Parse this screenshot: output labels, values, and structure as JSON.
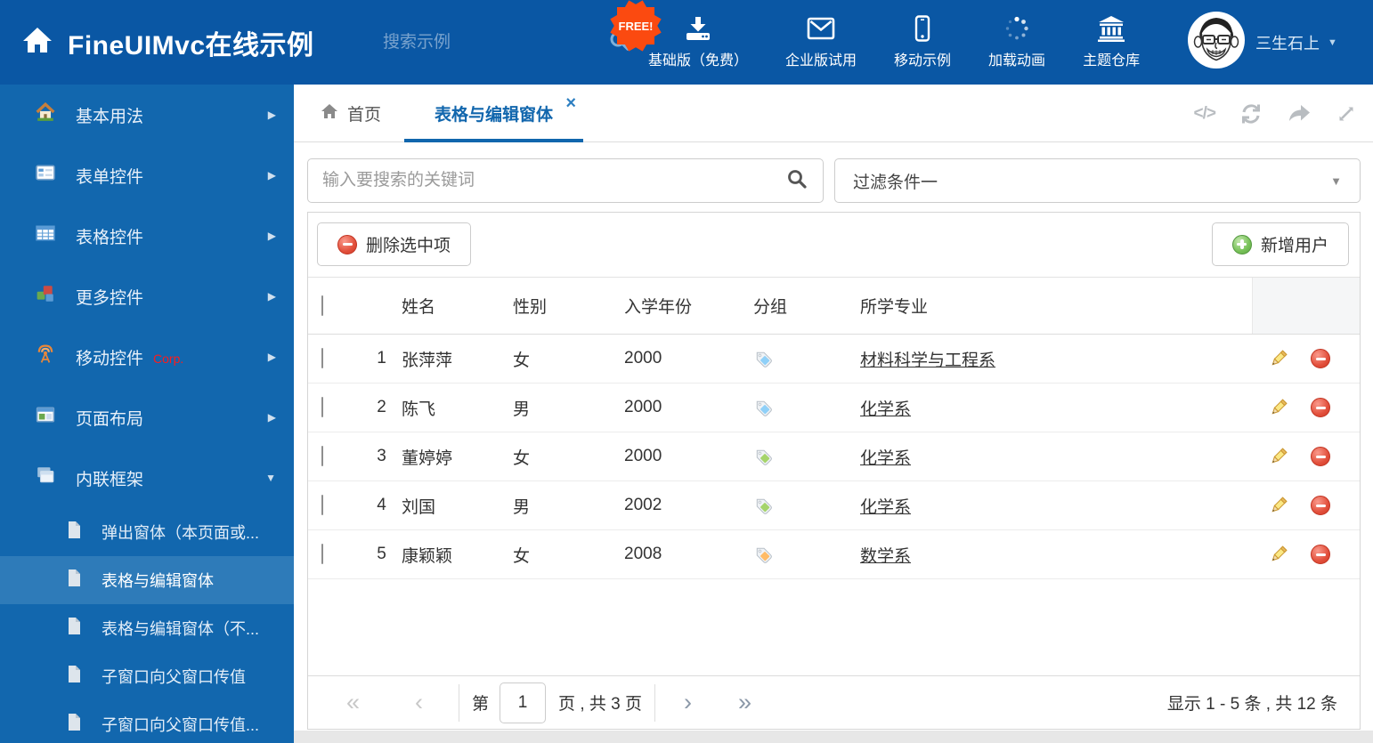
{
  "header": {
    "title": "FineUIMvc在线示例",
    "search_placeholder": "搜索示例",
    "free_badge": "FREE!",
    "nav_items": [
      {
        "label": "基础版（免费）",
        "icon": "download-icon"
      },
      {
        "label": "企业版试用",
        "icon": "envelope-icon"
      },
      {
        "label": "移动示例",
        "icon": "mobile-icon"
      },
      {
        "label": "加载动画",
        "icon": "spinner-icon"
      },
      {
        "label": "主题仓库",
        "icon": "bank-icon"
      }
    ],
    "username": "三生石上"
  },
  "sidebar": {
    "items": [
      {
        "label": "基本用法",
        "icon": "home-colorful-icon",
        "expanded": false
      },
      {
        "label": "表单控件",
        "icon": "form-icon",
        "expanded": false
      },
      {
        "label": "表格控件",
        "icon": "table-icon",
        "expanded": false
      },
      {
        "label": "更多控件",
        "icon": "cubes-icon",
        "expanded": false
      },
      {
        "label": "移动控件",
        "badge": "Corp.",
        "icon": "antenna-icon",
        "expanded": false
      },
      {
        "label": "页面布局",
        "icon": "layout-icon",
        "expanded": false
      },
      {
        "label": "内联框架",
        "icon": "frames-icon",
        "expanded": true
      }
    ],
    "subitems": [
      {
        "label": "弹出窗体（本页面或...",
        "selected": false
      },
      {
        "label": "表格与编辑窗体",
        "selected": true
      },
      {
        "label": "表格与编辑窗体（不...",
        "selected": false
      },
      {
        "label": "子窗口向父窗口传值",
        "selected": false
      },
      {
        "label": "子窗口向父窗口传值...",
        "selected": false
      }
    ]
  },
  "tabs": [
    {
      "label": "首页"
    },
    {
      "label": "表格与编辑窗体"
    }
  ],
  "filters": {
    "search_placeholder": "输入要搜索的关键词",
    "filter_value": "过滤条件一"
  },
  "toolbar": {
    "delete_label": "删除选中项",
    "add_label": "新增用户"
  },
  "table": {
    "headers": [
      "姓名",
      "性别",
      "入学年份",
      "分组",
      "所学专业"
    ],
    "rows": [
      {
        "index": "1",
        "name": "张萍萍",
        "gender": "女",
        "year": "2000",
        "tag_color": "#8fd0f8",
        "major": "材料科学与工程系"
      },
      {
        "index": "2",
        "name": "陈飞",
        "gender": "男",
        "year": "2000",
        "tag_color": "#8fd0f8",
        "major": "化学系"
      },
      {
        "index": "3",
        "name": "董婷婷",
        "gender": "女",
        "year": "2000",
        "tag_color": "#a5d46a",
        "major": "化学系"
      },
      {
        "index": "4",
        "name": "刘国",
        "gender": "男",
        "year": "2002",
        "tag_color": "#a5d46a",
        "major": "化学系"
      },
      {
        "index": "5",
        "name": "康颖颖",
        "gender": "女",
        "year": "2008",
        "tag_color": "#ffbb66",
        "major": "数学系"
      }
    ]
  },
  "pagination": {
    "page_prefix": "第",
    "current_page": "1",
    "page_suffix": "页 , 共 3 页",
    "summary": "显示 1 - 5 条 , 共 12 条"
  },
  "colors": {
    "header_bg": "#0a57a4",
    "sidebar_bg": "#1267ae",
    "sidebar_selected": "#2e7bb9",
    "accent_blue": "#1166ad",
    "free_badge": "#fb4a10",
    "corp_badge": "#ff1a1a",
    "delete_red": "#e2503c",
    "add_green": "#6fbf53",
    "tag_blue": "#8fd0f8",
    "tag_green": "#a5d46a",
    "tag_orange": "#ffbb66",
    "link_color": "#333333"
  }
}
